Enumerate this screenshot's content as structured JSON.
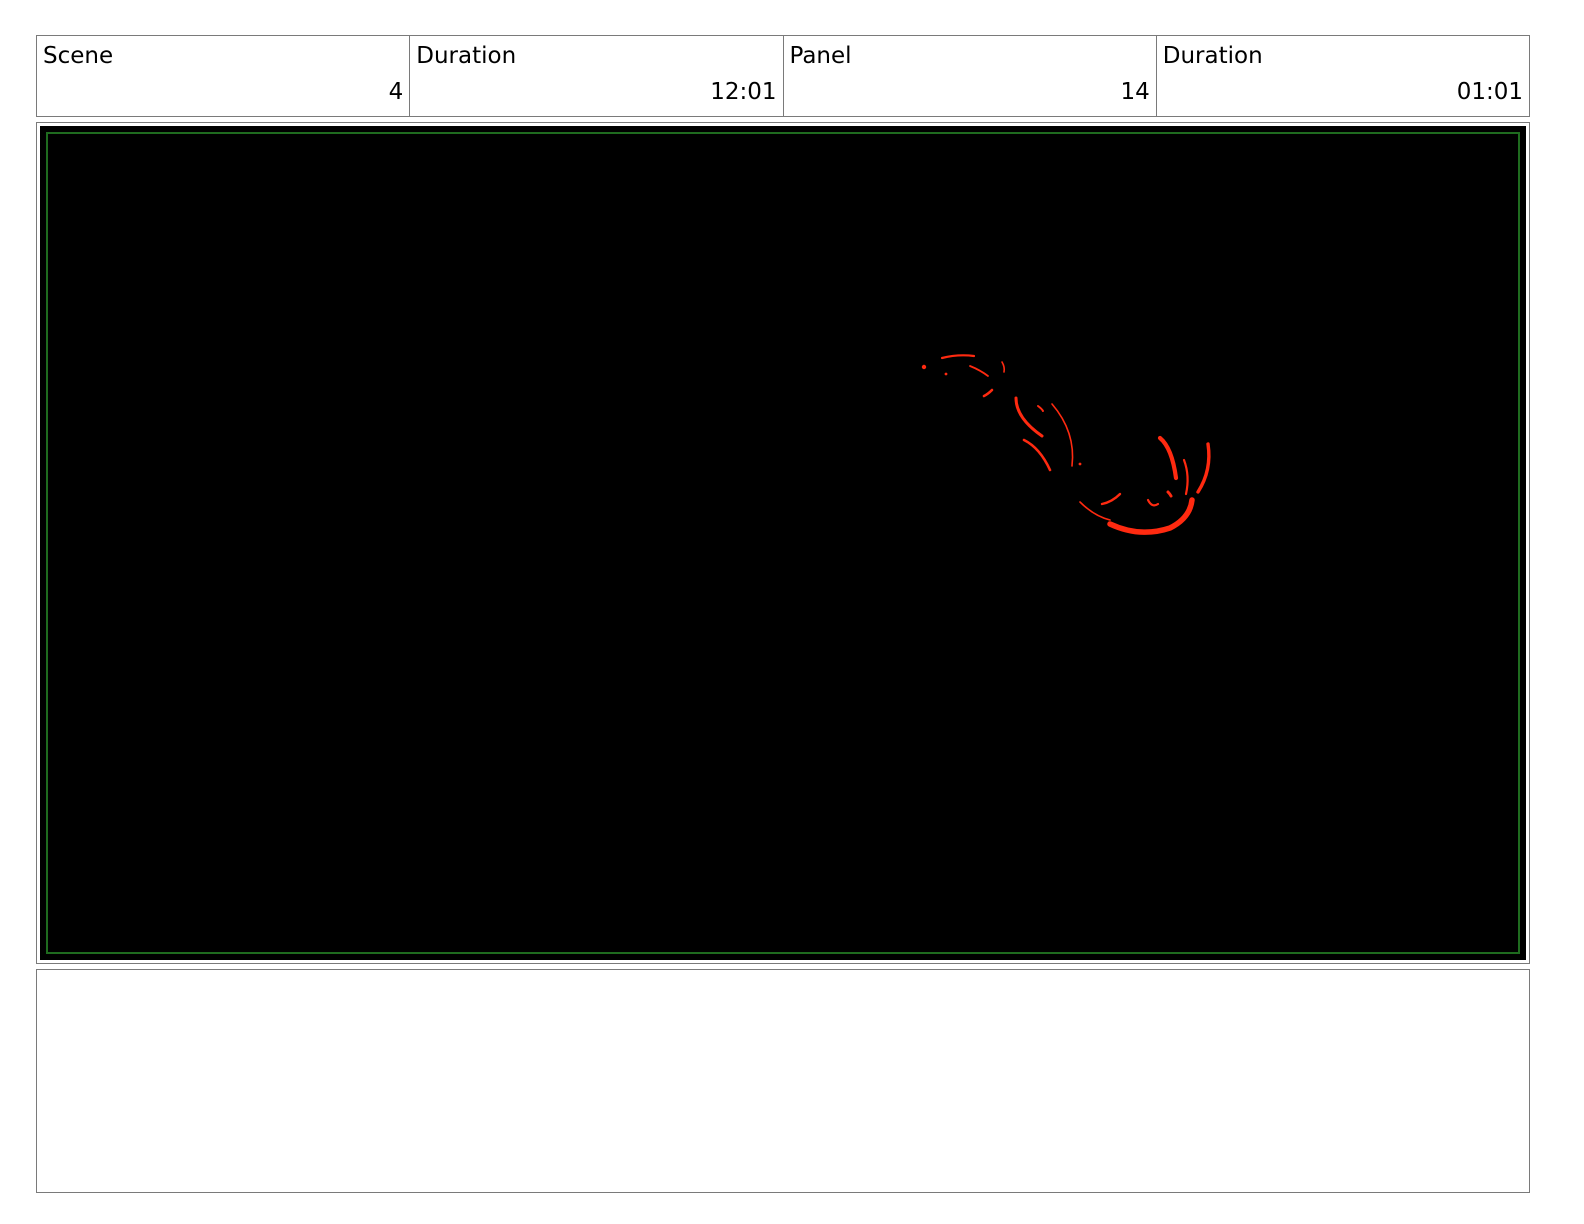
{
  "header": {
    "scene_label": "Scene",
    "scene_value": "4",
    "scene_duration_label": "Duration",
    "scene_duration_value": "12:01",
    "panel_label": "Panel",
    "panel_value": "14",
    "panel_duration_label": "Duration",
    "panel_duration_value": "01:01"
  },
  "panel": {
    "background_color": "#000000",
    "safe_area_color": "#1f6b1f",
    "sketch_color": "#ff2a10"
  },
  "notes": {
    "text": ""
  }
}
